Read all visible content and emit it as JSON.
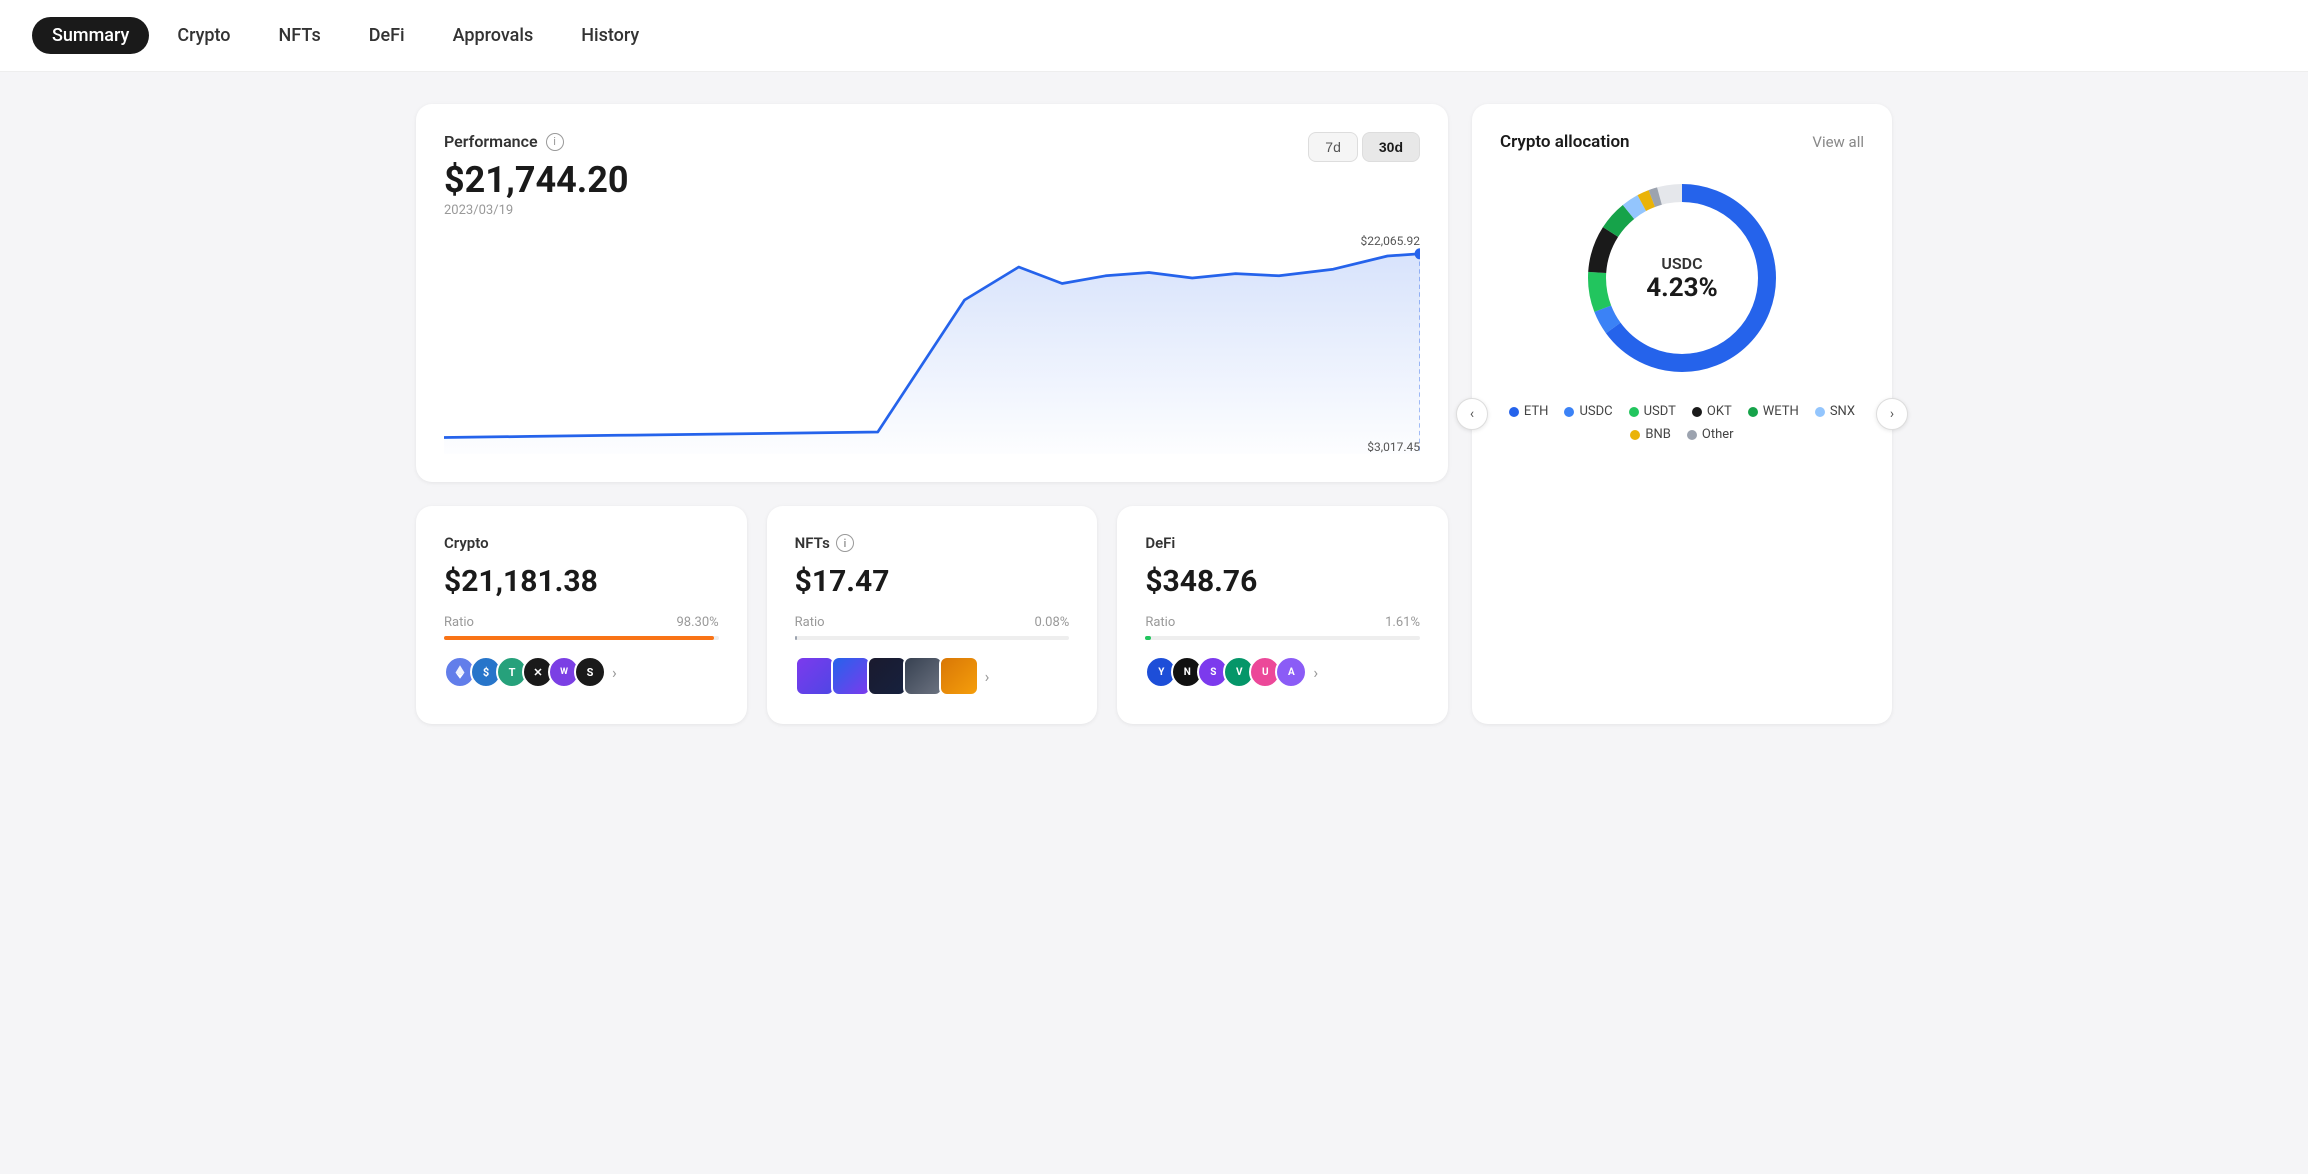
{
  "nav": {
    "items": [
      {
        "label": "Summary",
        "active": true
      },
      {
        "label": "Crypto",
        "active": false
      },
      {
        "label": "NFTs",
        "active": false
      },
      {
        "label": "DeFi",
        "active": false
      },
      {
        "label": "Approvals",
        "active": false
      },
      {
        "label": "History",
        "active": false
      }
    ]
  },
  "performance": {
    "title": "Performance",
    "amount": "$21,744.20",
    "date": "2023/03/19",
    "high_label": "$22,065.92",
    "low_label": "$3,017.45",
    "time_buttons": [
      {
        "label": "7d",
        "active": false
      },
      {
        "label": "30d",
        "active": true
      }
    ]
  },
  "allocation": {
    "title": "Crypto allocation",
    "view_all": "View all",
    "center_coin": "USDC",
    "center_pct": "4.23%",
    "legend": [
      {
        "label": "ETH",
        "color": "#2563eb"
      },
      {
        "label": "USDC",
        "color": "#3b82f6"
      },
      {
        "label": "USDT",
        "color": "#22c55e"
      },
      {
        "label": "OKT",
        "color": "#1a1a1a"
      },
      {
        "label": "WETH",
        "color": "#16a34a"
      },
      {
        "label": "SNX",
        "color": "#93c5fd"
      },
      {
        "label": "BNB",
        "color": "#eab308"
      },
      {
        "label": "Other",
        "color": "#9ca3af"
      }
    ],
    "left_arrow": "‹",
    "right_arrow": "›"
  },
  "crypto_card": {
    "title": "Crypto",
    "amount": "$21,181.38",
    "ratio_label": "Ratio",
    "ratio_pct": "98.30%",
    "ratio_fill_color": "#f97316",
    "ratio_fill_width": 98.3
  },
  "nfts_card": {
    "title": "NFTs",
    "amount": "$17.47",
    "ratio_label": "Ratio",
    "ratio_pct": "0.08%",
    "ratio_fill_color": "#9ca3af",
    "ratio_fill_width": 0.08
  },
  "defi_card": {
    "title": "DeFi",
    "amount": "$348.76",
    "ratio_label": "Ratio",
    "ratio_pct": "1.61%",
    "ratio_fill_color": "#22c55e",
    "ratio_fill_width": 1.61
  },
  "token_colors": {
    "eth": "#627eea",
    "usdc": "#2775ca",
    "usdt": "#26a17b",
    "x": "#1a1a1a",
    "weth": "#7b3fe4",
    "s": "#1c1c1c"
  }
}
